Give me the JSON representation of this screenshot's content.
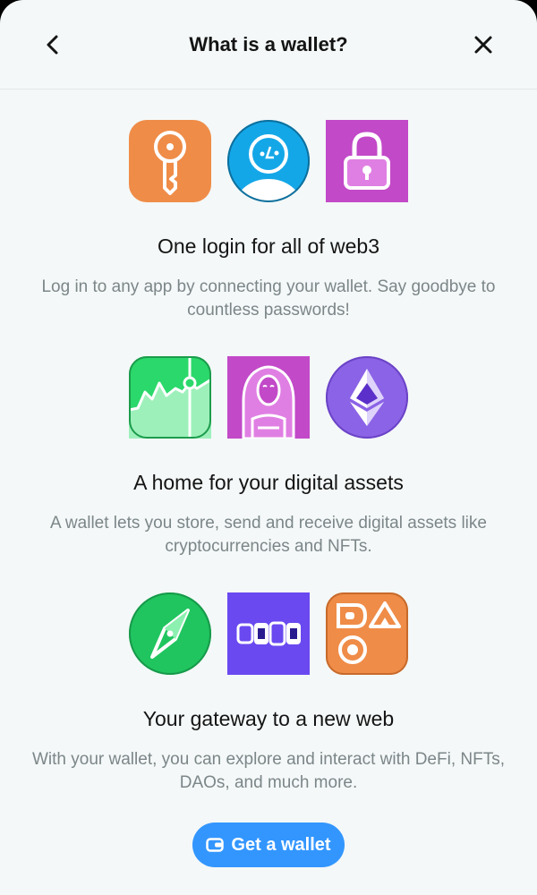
{
  "header": {
    "title": "What is a wallet?",
    "back_icon": "chevron-left-icon",
    "close_icon": "close-icon"
  },
  "sections": [
    {
      "icons": [
        "key-icon",
        "user-avatar-icon",
        "lock-icon"
      ],
      "title": "One login for all of web3",
      "description": "Log in to any app by connecting your wallet. Say goodbye to countless passwords!"
    },
    {
      "icons": [
        "chart-icon",
        "nft-painting-icon",
        "ethereum-icon"
      ],
      "title": "A home for your digital assets",
      "description": "A wallet lets you store, send and receive digital assets like cryptocurrencies and NFTs."
    },
    {
      "icons": [
        "compass-icon",
        "defi-blocks-icon",
        "dao-shapes-icon"
      ],
      "title": "Your gateway to a new web",
      "description": "With your wallet, you can explore and interact with DeFi, NFTs, DAOs, and much more."
    }
  ],
  "cta": {
    "label": "Get a wallet",
    "icon": "wallet-icon"
  },
  "colors": {
    "accent": "#3396ff",
    "background": "#f4f8f8",
    "icon_orange": "#ef8c48",
    "icon_blue": "#14a7e8",
    "icon_magenta": "#c249c8",
    "icon_green": "#2bd86b",
    "icon_purple": "#8b63e6",
    "icon_violet": "#6a49f0"
  }
}
